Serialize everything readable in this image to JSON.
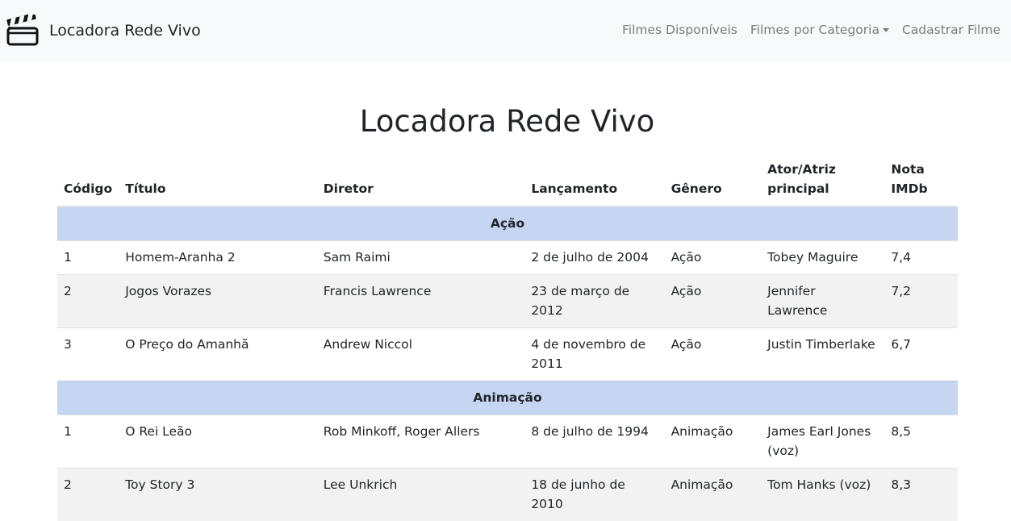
{
  "navbar": {
    "brand": "Locadora Rede Vivo",
    "brand_icon": "clapperboard-icon",
    "links": [
      "Filmes Disponíveis",
      "Filmes por Categoria",
      "Cadastrar Filme"
    ]
  },
  "page": {
    "title": "Locadora Rede Vivo"
  },
  "table": {
    "headers": [
      "Código",
      "Título",
      "Diretor",
      "Lançamento",
      "Gênero",
      "Ator/Atriz principal",
      "Nota IMDb"
    ],
    "groups": [
      {
        "name": "Ação",
        "rows": [
          [
            "1",
            "Homem-Aranha 2",
            "Sam Raimi",
            "2 de julho de 2004",
            "Ação",
            "Tobey Maguire",
            "7,4"
          ],
          [
            "2",
            "Jogos Vorazes",
            "Francis Lawrence",
            "23 de março de 2012",
            "Ação",
            "Jennifer Lawrence",
            "7,2"
          ],
          [
            "3",
            "O Preço do Amanhã",
            "Andrew Niccol",
            "4 de novembro de 2011",
            "Ação",
            "Justin Timberlake",
            "6,7"
          ]
        ]
      },
      {
        "name": "Animação",
        "rows": [
          [
            "1",
            "O Rei Leão",
            "Rob Minkoff, Roger Allers",
            "8 de julho de 1994",
            "Animação",
            "James Earl Jones (voz)",
            "8,5"
          ],
          [
            "2",
            "Toy Story 3",
            "Lee Unkrich",
            "18 de junho de 2010",
            "Animação",
            "Tom Hanks (voz)",
            "8,3"
          ]
        ]
      }
    ]
  },
  "colors": {
    "navbar_bg": "#f8f9fa",
    "group_row_bg": "#c5d5f2",
    "striped_row_bg": "#f2f2f2"
  }
}
